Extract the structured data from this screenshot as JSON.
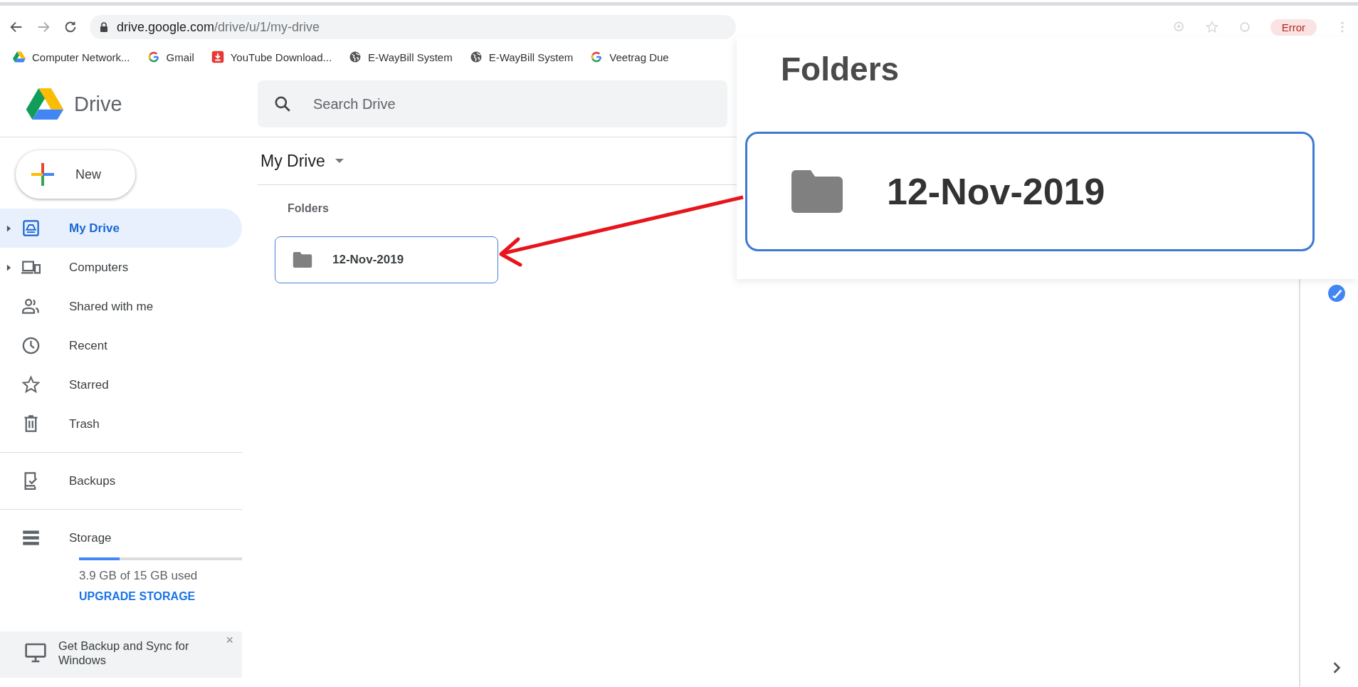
{
  "browser": {
    "address_host": "drive.google.com",
    "address_path": "/drive/u/1/my-drive",
    "error_badge": "Error",
    "bookmarks": [
      {
        "label": "Computer Network...",
        "kind": "drive"
      },
      {
        "label": "Gmail",
        "kind": "google"
      },
      {
        "label": "YouTube Download...",
        "kind": "download"
      },
      {
        "label": "E-WayBill System",
        "kind": "globe"
      },
      {
        "label": "E-WayBill System",
        "kind": "globe"
      },
      {
        "label": "Veetrag Due",
        "kind": "google"
      }
    ]
  },
  "app": {
    "logo_text": "Drive",
    "search": {
      "placeholder": "Search Drive"
    }
  },
  "sidebar": {
    "new_button": "New",
    "items": [
      {
        "label": "My Drive",
        "kind": "drive",
        "expandable": true,
        "selected": true,
        "divider_before": false
      },
      {
        "label": "Computers",
        "kind": "computers",
        "expandable": true,
        "selected": false,
        "divider_before": false
      },
      {
        "label": "Shared with me",
        "kind": "shared",
        "expandable": false,
        "selected": false,
        "divider_before": false
      },
      {
        "label": "Recent",
        "kind": "recent",
        "expandable": false,
        "selected": false,
        "divider_before": false
      },
      {
        "label": "Starred",
        "kind": "starred",
        "expandable": false,
        "selected": false,
        "divider_before": false
      },
      {
        "label": "Trash",
        "kind": "trash",
        "expandable": false,
        "selected": false,
        "divider_before": false
      },
      {
        "label": "Backups",
        "kind": "backups",
        "expandable": false,
        "selected": false,
        "divider_before": true
      },
      {
        "label": "Storage",
        "kind": "storage",
        "expandable": false,
        "selected": false,
        "divider_before": true
      }
    ],
    "storage": {
      "level": 0.25,
      "usage": "3.9 GB of 15 GB used",
      "upgrade": "UPGRADE STORAGE"
    },
    "promo": {
      "text": "Get Backup and Sync for Windows",
      "close": "×"
    }
  },
  "main": {
    "title": "My Drive",
    "section": "Folders",
    "folders": [
      {
        "name": "12-Nov-2019",
        "selected": true
      }
    ]
  },
  "callout": {
    "title": "Folders",
    "folder": "12-Nov-2019"
  }
}
